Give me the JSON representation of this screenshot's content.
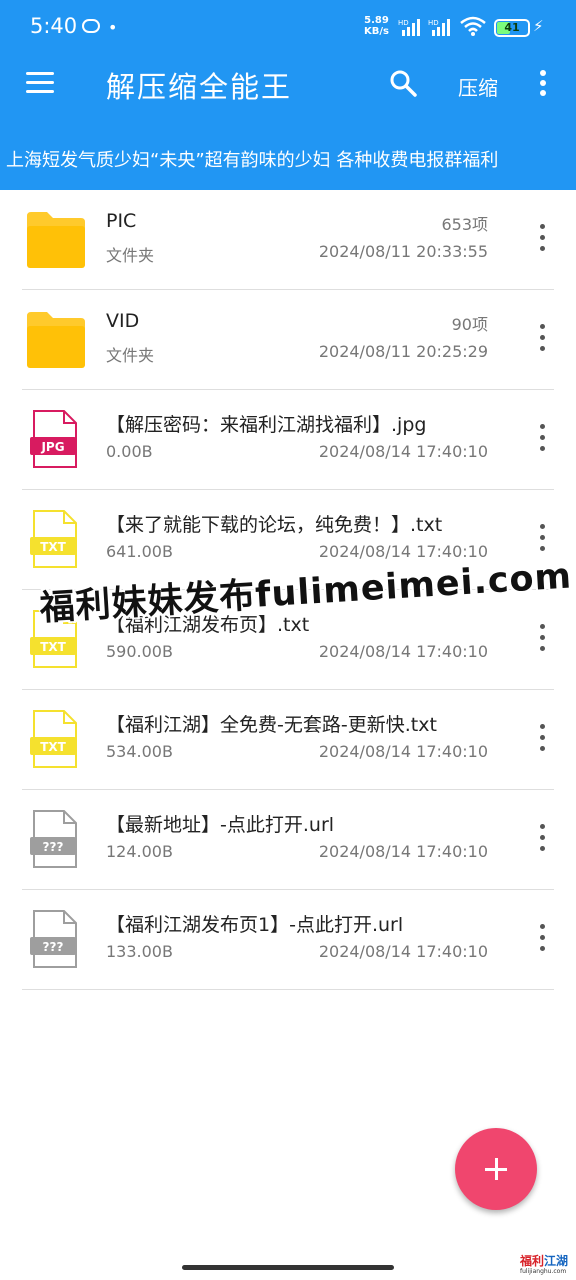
{
  "status_bar": {
    "time": "5:40",
    "dot": "•",
    "speed_value": "5.89",
    "speed_unit": "KB/s",
    "battery": "41",
    "battery_fraction": 0.41
  },
  "toolbar": {
    "title": "解压缩全能王",
    "compress_label": "压缩"
  },
  "marquee": {
    "text": "上海短发气质少妇“未央”超有韵味的少妇 各种收费电报群福利"
  },
  "files": [
    {
      "name": "PIC",
      "sub": "文件夹",
      "count": "653项",
      "date": "2024/08/11 20:33:55",
      "icon": "folder-icon"
    },
    {
      "name": "VID",
      "sub": "文件夹",
      "count": "90项",
      "date": "2024/08/11 20:25:29",
      "icon": "folder-icon"
    },
    {
      "name": "【解压密码：来福利江湖找福利】.jpg",
      "sub": "0.00B",
      "count": "",
      "date": "2024/08/14 17:40:10",
      "icon": "jpg-file-icon",
      "badge": "JPG"
    },
    {
      "name": "【来了就能下载的论坛，纯免费！】.txt",
      "sub": "641.00B",
      "count": "",
      "date": "2024/08/14 17:40:10",
      "icon": "txt-file-icon",
      "badge": "TXT"
    },
    {
      "name": "【福利江湖发布页】.txt",
      "sub": "590.00B",
      "count": "",
      "date": "2024/08/14 17:40:10",
      "icon": "txt-file-icon",
      "badge": "TXT"
    },
    {
      "name": "【福利江湖】全免费-无套路-更新快.txt",
      "sub": "534.00B",
      "count": "",
      "date": "2024/08/14 17:40:10",
      "icon": "txt-file-icon",
      "badge": "TXT"
    },
    {
      "name": "【最新地址】-点此打开.url",
      "sub": "124.00B",
      "count": "",
      "date": "2024/08/14 17:40:10",
      "icon": "unknown-file-icon",
      "badge": "???"
    },
    {
      "name": "【福利江湖发布页1】-点此打开.url",
      "sub": "133.00B",
      "count": "",
      "date": "2024/08/14 17:40:10",
      "icon": "unknown-file-icon",
      "badge": "???"
    }
  ],
  "watermark": {
    "text": "福利妹妹发布fulimeimei.com"
  },
  "corner_logo": {
    "text_a": "福利",
    "text_b": "江湖",
    "sub": "fulijianghu.com"
  },
  "colors": {
    "primary": "#2196f3",
    "fab": "#f0466e",
    "folder": "#ffc107",
    "jpg": "#d81b60",
    "txt": "#f5e12e",
    "unknown": "#9e9e9e"
  }
}
